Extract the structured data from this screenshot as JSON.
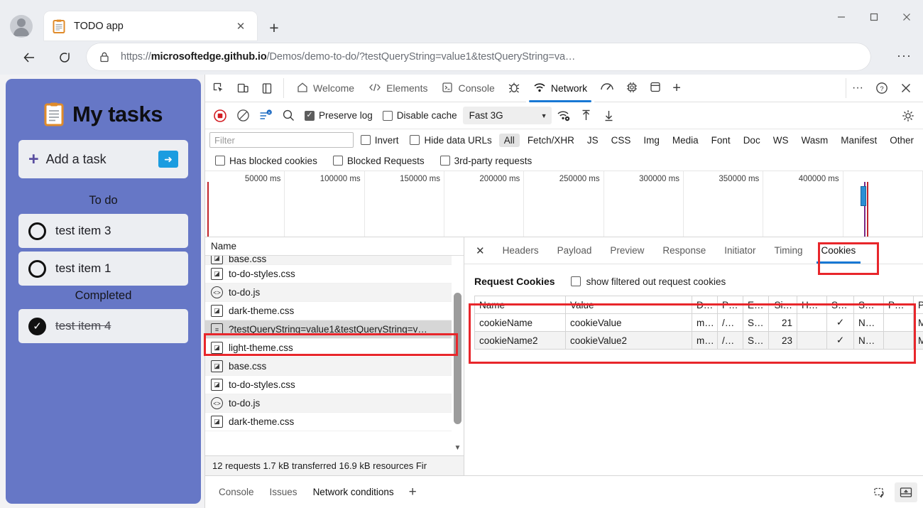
{
  "browser": {
    "tab": {
      "title": "TODO app",
      "favicon": "clipboard-icon",
      "close": "✕"
    },
    "new_tab": "+",
    "window_controls": {
      "minimize": "—",
      "maximize": "▢",
      "close": "✕"
    },
    "nav": {
      "back": "←",
      "reload": "⟳",
      "more": "···"
    },
    "omnibox": {
      "lock": "lock-icon",
      "scheme": "https://",
      "host": "microsoftedge.github.io",
      "path": "/Demos/demo-to-do/?testQueryString=value1&testQueryString=va…",
      "full_url": "https://microsoftedge.github.io/Demos/demo-to-do/?testQueryString=value1&testQueryString=va…"
    }
  },
  "todo_app": {
    "title": "My tasks",
    "add_task_label": "Add a task",
    "add_task_plus": "+",
    "go_button": "➜",
    "sections": [
      {
        "label": "To do",
        "items": [
          {
            "text": "test item 3",
            "done": false
          },
          {
            "text": "test item 1",
            "done": false
          }
        ]
      },
      {
        "label": "Completed",
        "items": [
          {
            "text": "test item 4",
            "done": true
          }
        ]
      }
    ]
  },
  "devtools": {
    "panel_tabs": [
      {
        "label": "Welcome",
        "icon": "home-icon",
        "active": false
      },
      {
        "label": "Elements",
        "icon": "code-icon",
        "active": false
      },
      {
        "label": "Console",
        "icon": "console-icon",
        "active": false
      },
      {
        "label": "",
        "icon": "bug-icon",
        "active": false
      },
      {
        "label": "Network",
        "icon": "network-icon",
        "active": true
      },
      {
        "label": "",
        "icon": "performance-icon",
        "active": false
      },
      {
        "label": "",
        "icon": "memory-icon",
        "active": false
      },
      {
        "label": "",
        "icon": "application-icon",
        "active": false
      },
      {
        "label": "",
        "icon": "plus-icon",
        "active": false
      }
    ],
    "dock_icons": [
      "inspect-icon",
      "device-emulation-icon",
      "dock-side-icon"
    ],
    "tabbar_right": {
      "more": "···",
      "help": "?",
      "close": "✕"
    },
    "toolbar": {
      "record_icon": "record-stop-icon",
      "clear_icon": "clear-icon",
      "filter_icon": "filter-icon",
      "search_icon": "search-icon",
      "preserve_log": {
        "label": "Preserve log",
        "checked": true
      },
      "disable_cache": {
        "label": "Disable cache",
        "checked": false
      },
      "throttle": {
        "value": "Fast 3G",
        "caret": "▼"
      },
      "throttle_settings_icon": "network-conditions-icon",
      "import_icon": "import-har-icon",
      "export_icon": "export-har-icon",
      "settings_icon": "gear-icon"
    },
    "filter_bar": {
      "filter_placeholder": "Filter",
      "invert": {
        "label": "Invert",
        "checked": false
      },
      "hide_data_urls": {
        "label": "Hide data URLs",
        "checked": false
      },
      "types": [
        "All",
        "Fetch/XHR",
        "JS",
        "CSS",
        "Img",
        "Media",
        "Font",
        "Doc",
        "WS",
        "Wasm",
        "Manifest",
        "Other"
      ],
      "active_type": "All",
      "has_blocked_cookies": {
        "label": "Has blocked cookies",
        "checked": false
      },
      "blocked_requests": {
        "label": "Blocked Requests",
        "checked": false
      },
      "third_party_requests": {
        "label": "3rd-party requests",
        "checked": false
      }
    },
    "overview": {
      "ticks": [
        "50000 ms",
        "100000 ms",
        "150000 ms",
        "200000 ms",
        "250000 ms",
        "300000 ms",
        "350000 ms",
        "400000 ms"
      ]
    },
    "requests": {
      "column_header": "Name",
      "rows": [
        {
          "name": "base.css",
          "type": "stylesheet-icon",
          "selected": false,
          "partial": true
        },
        {
          "name": "to-do-styles.css",
          "type": "stylesheet-icon",
          "selected": false
        },
        {
          "name": "to-do.js",
          "type": "script-icon",
          "selected": false
        },
        {
          "name": "dark-theme.css",
          "type": "stylesheet-icon",
          "selected": false
        },
        {
          "name": "?testQueryString=value1&testQueryString=v…",
          "type": "document-icon",
          "selected": true
        },
        {
          "name": "light-theme.css",
          "type": "stylesheet-icon",
          "selected": false
        },
        {
          "name": "base.css",
          "type": "stylesheet-icon",
          "selected": false
        },
        {
          "name": "to-do-styles.css",
          "type": "stylesheet-icon",
          "selected": false
        },
        {
          "name": "to-do.js",
          "type": "script-icon",
          "selected": false
        },
        {
          "name": "dark-theme.css",
          "type": "stylesheet-icon",
          "selected": false
        }
      ],
      "status": "12 requests  1.7 kB transferred  16.9 kB resources  Fir"
    },
    "detail": {
      "close": "✕",
      "tabs": [
        "Headers",
        "Payload",
        "Preview",
        "Response",
        "Initiator",
        "Timing",
        "Cookies"
      ],
      "active_tab": "Cookies",
      "request_cookies_title": "Request Cookies",
      "show_filtered_label": "show filtered out request cookies",
      "show_filtered_checked": false,
      "cookie_columns": [
        "Name",
        "Value",
        "D…",
        "P…",
        "E…",
        "Si…",
        "H…",
        "S…",
        "S…",
        "P…",
        "P."
      ],
      "cookie_rows": [
        {
          "name": "cookieName",
          "value": "cookieValue",
          "domain": "m…",
          "path": "/…",
          "expires": "S…",
          "size": "21",
          "httponly": "",
          "secure": "✓",
          "samesite": "N…",
          "partition": "",
          "priority": "M…"
        },
        {
          "name": "cookieName2",
          "value": "cookieValue2",
          "domain": "m…",
          "path": "/…",
          "expires": "S…",
          "size": "23",
          "httponly": "",
          "secure": "✓",
          "samesite": "N…",
          "partition": "",
          "priority": "M…"
        }
      ]
    },
    "drawer": {
      "tabs": [
        "Console",
        "Issues",
        "Network conditions"
      ],
      "active_tab": "Network conditions",
      "plus": "+",
      "right_icons": [
        "restore-drawer-icon",
        "dock-drawer-icon"
      ]
    }
  },
  "highlights": {
    "color": "#e8262b",
    "count": 3
  }
}
